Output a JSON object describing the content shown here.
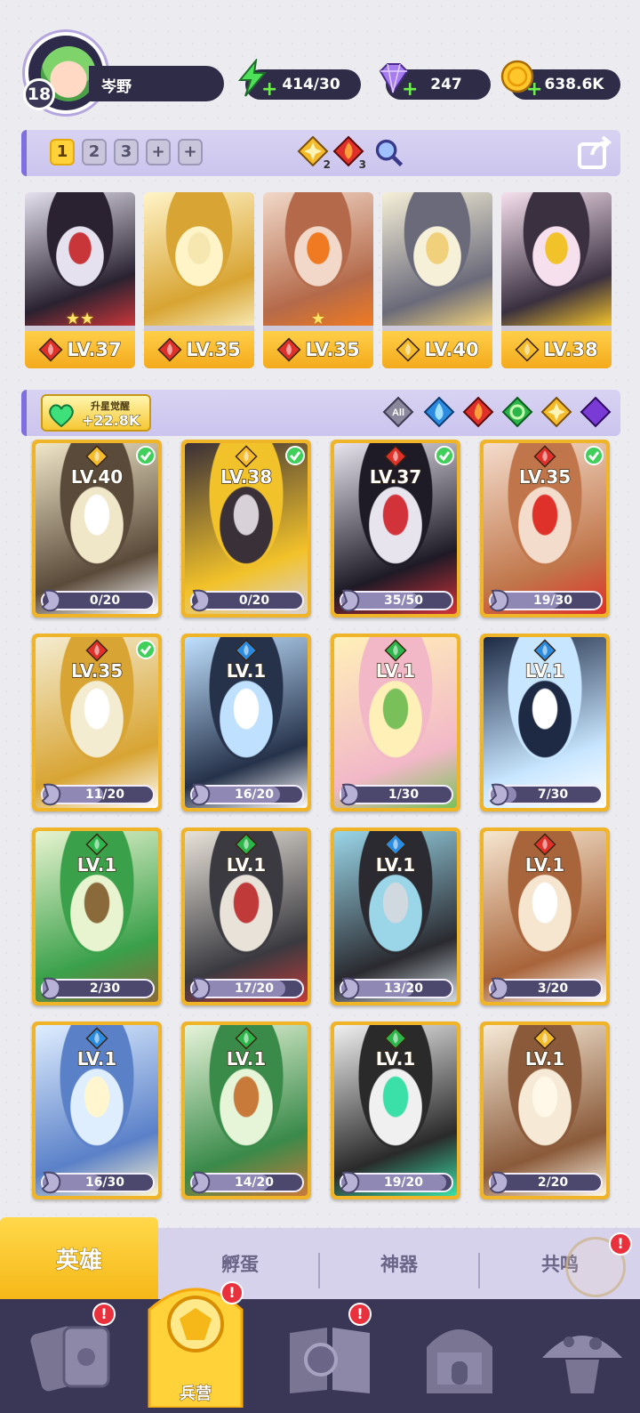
{
  "player": {
    "level": "18",
    "name": "岑野"
  },
  "resources": {
    "stamina": "414/30",
    "gems": "247",
    "gold": "638.6K"
  },
  "team_tabs": [
    "1",
    "2",
    "3",
    "+",
    "+"
  ],
  "team_elements": {
    "light": "2",
    "fire": "3"
  },
  "lineup": [
    {
      "element": "fire",
      "level": "LV.37",
      "stars": 2,
      "palette": [
        "#e5e1ee",
        "#2a2230",
        "#c9363a"
      ]
    },
    {
      "element": "fire",
      "level": "LV.35",
      "stars": 0,
      "palette": [
        "#fff4c8",
        "#d8a433",
        "#f6e7b0"
      ]
    },
    {
      "element": "fire",
      "level": "LV.35",
      "stars": 1,
      "palette": [
        "#f1d8c8",
        "#b46a4a",
        "#f07a22"
      ]
    },
    {
      "element": "light",
      "level": "LV.40",
      "stars": 0,
      "palette": [
        "#f6f0d8",
        "#6a6a7a",
        "#f0d07a"
      ]
    },
    {
      "element": "light",
      "level": "LV.38",
      "stars": 0,
      "palette": [
        "#f6e0ee",
        "#3a3040",
        "#f2c22a"
      ]
    }
  ],
  "filter_bar": {
    "upgrade_label": "升星觉醒",
    "upgrade_value": "+22.8K",
    "all_label": "All"
  },
  "heroes": [
    {
      "element": "light",
      "level": "LV.40",
      "shards": "0/20",
      "progress": 0.0,
      "checked": true,
      "palette": [
        "#f0e6c8",
        "#5a4a3a",
        "#ffffff"
      ]
    },
    {
      "element": "light",
      "level": "LV.38",
      "shards": "0/20",
      "progress": 0.0,
      "checked": true,
      "palette": [
        "#3a3038",
        "#f2c22a",
        "#d8d2d8"
      ]
    },
    {
      "element": "fire",
      "level": "LV.37",
      "shards": "35/50",
      "progress": 0.7,
      "checked": true,
      "palette": [
        "#e8e4ee",
        "#1e1a26",
        "#d2323a"
      ]
    },
    {
      "element": "fire",
      "level": "LV.35",
      "shards": "19/30",
      "progress": 0.63,
      "checked": true,
      "palette": [
        "#f4dccc",
        "#c0764a",
        "#e0302a"
      ]
    },
    {
      "element": "fire",
      "level": "LV.35",
      "shards": "11/20",
      "progress": 0.55,
      "checked": true,
      "palette": [
        "#f4ecd0",
        "#d8a433",
        "#ffffff"
      ]
    },
    {
      "element": "water",
      "level": "LV.1",
      "shards": "16/20",
      "progress": 0.8,
      "checked": false,
      "palette": [
        "#bfe0ff",
        "#26324a",
        "#ffffff"
      ]
    },
    {
      "element": "nature",
      "level": "LV.1",
      "shards": "1/30",
      "progress": 0.03,
      "checked": false,
      "palette": [
        "#fff0b8",
        "#f2b8c8",
        "#7ac05a"
      ]
    },
    {
      "element": "water",
      "level": "LV.1",
      "shards": "7/30",
      "progress": 0.23,
      "checked": false,
      "palette": [
        "#1e2a44",
        "#c8e6ff",
        "#ffffff"
      ]
    },
    {
      "element": "nature",
      "level": "LV.1",
      "shards": "2/30",
      "progress": 0.07,
      "checked": false,
      "palette": [
        "#e8f4d0",
        "#3aa04a",
        "#8a6a3a"
      ]
    },
    {
      "element": "nature",
      "level": "LV.1",
      "shards": "17/20",
      "progress": 0.85,
      "checked": false,
      "palette": [
        "#e8e2d8",
        "#3a3a40",
        "#c03a3a"
      ]
    },
    {
      "element": "water",
      "level": "LV.1",
      "shards": "13/20",
      "progress": 0.65,
      "checked": false,
      "palette": [
        "#9ad6e8",
        "#2a2a30",
        "#d0d8e0"
      ]
    },
    {
      "element": "fire",
      "level": "LV.1",
      "shards": "3/20",
      "progress": 0.15,
      "checked": false,
      "palette": [
        "#f6e6d0",
        "#a8643a",
        "#ffffff"
      ]
    },
    {
      "element": "water",
      "level": "LV.1",
      "shards": "16/30",
      "progress": 0.53,
      "checked": false,
      "palette": [
        "#dfeeff",
        "#5a80c8",
        "#fff6d0"
      ]
    },
    {
      "element": "nature",
      "level": "LV.1",
      "shards": "14/20",
      "progress": 0.7,
      "checked": false,
      "palette": [
        "#e6f4d8",
        "#3a8a4a",
        "#c87a3a"
      ]
    },
    {
      "element": "nature",
      "level": "LV.1",
      "shards": "19/20",
      "progress": 0.95,
      "checked": false,
      "palette": [
        "#f0f0f0",
        "#2a2a2a",
        "#3ae0a8"
      ]
    },
    {
      "element": "light",
      "level": "LV.1",
      "shards": "2/20",
      "progress": 0.1,
      "checked": false,
      "palette": [
        "#f6ead6",
        "#8a5a3a",
        "#fff8e8"
      ]
    }
  ],
  "element_colors": {
    "fire": "#e0302a",
    "water": "#2a8be0",
    "nature": "#2bb54a",
    "light": "#f4bb2a",
    "dark": "#7a3ad6"
  },
  "subtabs": [
    "英雄",
    "孵蛋",
    "神器",
    "共鸣"
  ],
  "nav": {
    "barracks": "兵营"
  }
}
